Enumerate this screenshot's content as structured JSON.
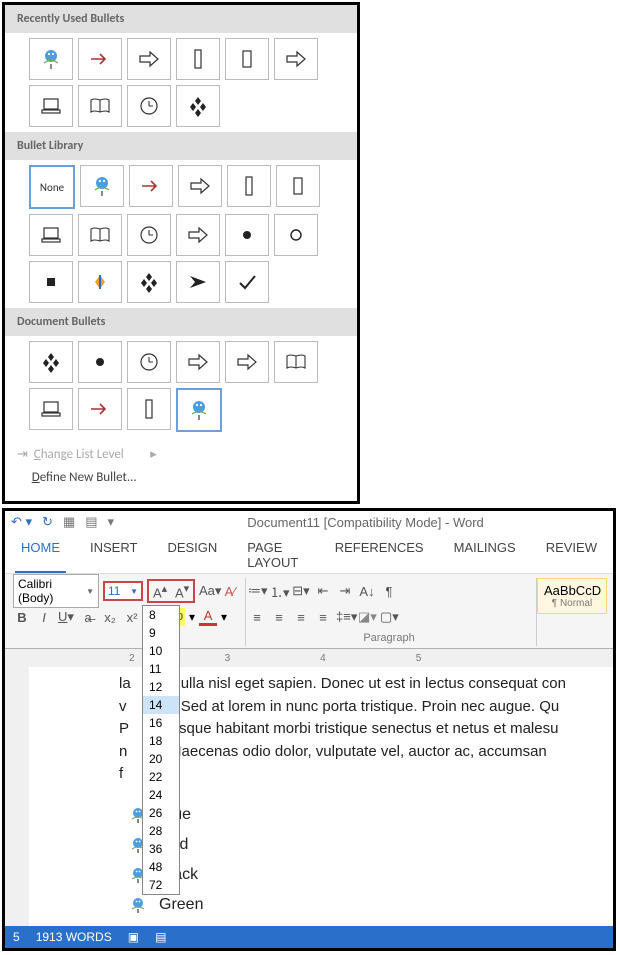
{
  "bullet_menu": {
    "section1": "Recently Used Bullets",
    "section2": "Bullet Library",
    "section3": "Document Bullets",
    "none_label": "None",
    "change_level": "hange List Level",
    "change_level_prefix": "C",
    "define_new": "efine New Bullet...",
    "define_new_prefix": "D"
  },
  "word": {
    "title": "Document11 [Compatibility Mode] - Word",
    "tabs": [
      "HOME",
      "INSERT",
      "DESIGN",
      "PAGE LAYOUT",
      "REFERENCES",
      "MAILINGS",
      "REVIEW"
    ],
    "font_name": "Calibri (Body)",
    "font_size": "11",
    "font_sizes": [
      "8",
      "9",
      "10",
      "11",
      "12",
      "14",
      "16",
      "18",
      "20",
      "22",
      "24",
      "26",
      "28",
      "36",
      "48",
      "72"
    ],
    "selected_size": "14",
    "group_label": "Paragraph",
    "style_preview": "AaBbCcD",
    "style_name": "¶ Normal",
    "body_lines": [
      "la",
      "nulla nisl eget sapien. Donec ut est in lectus consequat con",
      "v",
      "t. Sed at lorem in nunc porta tristique. Proin nec augue. Qu",
      "P",
      "esque habitant morbi tristique senectus et netus et malesu",
      "n",
      "Maecenas odio dolor, vulputate vel, auctor ac, accumsan",
      "f"
    ],
    "bullet_items": [
      "Blue",
      "Red",
      "Black",
      "Green"
    ],
    "status_words": "1913 WORDS",
    "status_page": "5"
  }
}
